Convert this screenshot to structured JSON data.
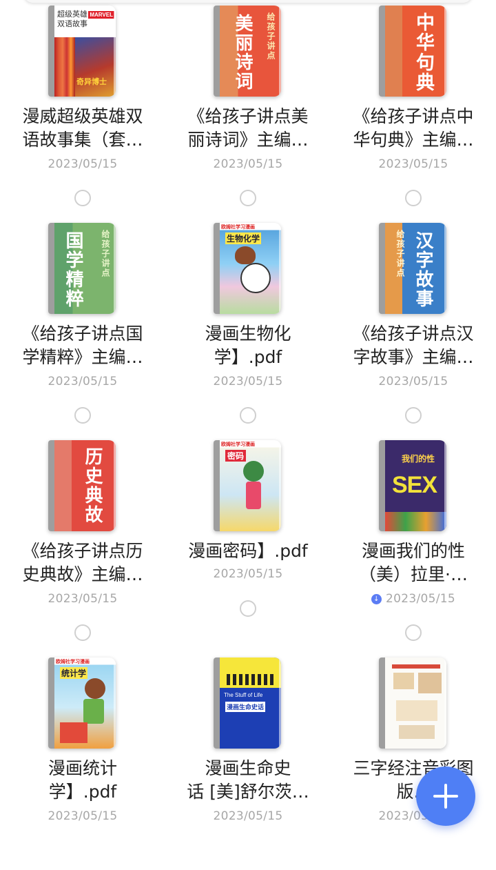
{
  "files": [
    {
      "title_line1": "漫威超级英雄双",
      "title_line2": "语故事集（套…",
      "date": "2023/05/15",
      "cover_text": "超级英雄\n双语故事",
      "cover_badge": "MARVEL",
      "cover_sub": "奇异博士"
    },
    {
      "title_line1": "《给孩子讲点美",
      "title_line2": "丽诗词》主编…",
      "date": "2023/05/15",
      "cover_text": "美丽诗词",
      "cover_series": "给孩子讲点"
    },
    {
      "title_line1": "《给孩子讲点中",
      "title_line2": "华句典》主编…",
      "date": "2023/05/15",
      "cover_text": "中华句典"
    },
    {
      "title_line1": "《给孩子讲点国",
      "title_line2": "学精粹》主编…",
      "date": "2023/05/15",
      "cover_text": "国学精粹",
      "cover_series": "给孩子讲点"
    },
    {
      "title_line1": "漫画生物化",
      "title_line2": "学】.pdf",
      "date": "2023/05/15",
      "cover_text": "生物化学",
      "cover_series": "欧姆社学习漫画"
    },
    {
      "title_line1": "《给孩子讲点汉",
      "title_line2": "字故事》主编…",
      "date": "2023/05/15",
      "cover_text": "汉字故事",
      "cover_series": "给孩子讲点"
    },
    {
      "title_line1": "《给孩子讲点历",
      "title_line2": "史典故》主编…",
      "date": "2023/05/15",
      "cover_text": "历史典故"
    },
    {
      "title_line1": "漫画密码】.pdf",
      "title_line2": "",
      "date": "2023/05/15",
      "cover_text": "密码",
      "cover_series": "欧姆社学习漫画"
    },
    {
      "title_line1": "漫画我们的性",
      "title_line2": "（美）拉里·…",
      "date": "2023/05/15",
      "cover_text": "我们的性",
      "cover_sub": "SEX",
      "downloading": true
    },
    {
      "title_line1": "漫画统计",
      "title_line2": "学】.pdf",
      "date": "2023/05/15",
      "cover_text": "统计学",
      "cover_series": "欧姆社学习漫画"
    },
    {
      "title_line1": "漫画生命史",
      "title_line2": "话 [美]舒尔茨…",
      "date": "2023/05/15",
      "cover_text": "漫画生命史话",
      "cover_sub": "The Stuff of Life"
    },
    {
      "title_line1": "三字经注音彩图",
      "title_line2": "版.p",
      "date": "2023/05/15",
      "cover_text": ""
    }
  ],
  "fab": {
    "icon": "plus-icon",
    "color": "#4f7ff5"
  },
  "colors": {
    "date": "#a7a7a7",
    "radio_border": "#cfcfcf",
    "accent": "#5b7cf4"
  }
}
